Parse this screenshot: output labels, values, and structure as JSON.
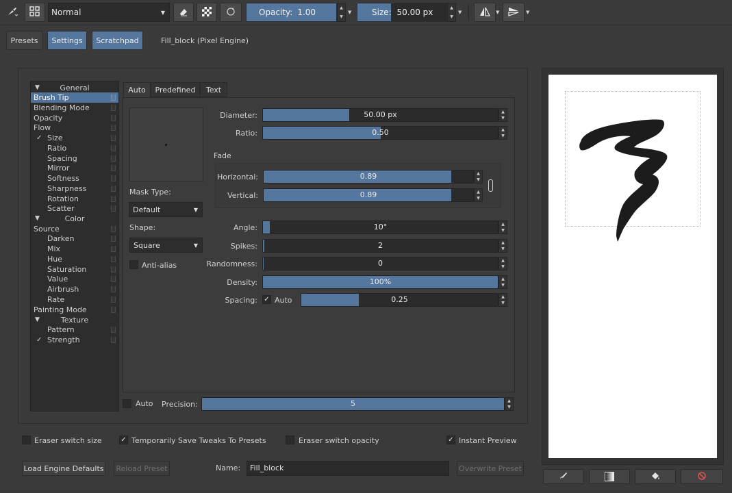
{
  "toolbar": {
    "blend_mode": "Normal",
    "opacity_label": "Opacity:",
    "opacity_value": "1.00",
    "size_label": "Size:",
    "size_value": "50.00 px"
  },
  "tabs": {
    "presets": "Presets",
    "settings": "Settings",
    "scratchpad": "Scratchpad",
    "preset_name": "Fill_block (Pixel Engine)"
  },
  "tree": {
    "general": "General",
    "brush_tip": "Brush Tip",
    "blending_mode": "Blending Mode",
    "opacity": "Opacity",
    "flow": "Flow",
    "size": "Size",
    "ratio": "Ratio",
    "spacing": "Spacing",
    "mirror": "Mirror",
    "softness": "Softness",
    "sharpness": "Sharpness",
    "rotation": "Rotation",
    "scatter": "Scatter",
    "color": "Color",
    "source": "Source",
    "darken": "Darken",
    "mix": "Mix",
    "hue": "Hue",
    "saturation": "Saturation",
    "value": "Value",
    "airbrush": "Airbrush",
    "rate": "Rate",
    "painting_mode": "Painting Mode",
    "texture": "Texture",
    "pattern": "Pattern",
    "strength": "Strength"
  },
  "tip_tabs": {
    "auto": "Auto",
    "predefined": "Predefined",
    "text": "Text"
  },
  "mask": {
    "mask_type_label": "Mask Type:",
    "mask_type_value": "Default",
    "shape_label": "Shape:",
    "shape_value": "Square",
    "anti_alias": "Anti-alias"
  },
  "params": {
    "diameter_label": "Diameter:",
    "diameter_value": "50.00 px",
    "ratio_label": "Ratio:",
    "ratio_value": "0.50",
    "fade_label": "Fade",
    "horizontal_label": "Horizontal:",
    "horizontal_value": "0.89",
    "vertical_label": "Vertical:",
    "vertical_value": "0.89",
    "angle_label": "Angle:",
    "angle_value": "10°",
    "spikes_label": "Spikes:",
    "spikes_value": "2",
    "randomness_label": "Randomness:",
    "randomness_value": "0",
    "density_label": "Density:",
    "density_value": "100%",
    "spacing_label": "Spacing:",
    "spacing_auto": "Auto",
    "spacing_value": "0.25",
    "precision_auto": "Auto",
    "precision_label": "Precision:",
    "precision_value": "5"
  },
  "bottom": {
    "eraser_switch_size": "Eraser switch size",
    "temp_save": "Temporarily Save Tweaks To Presets",
    "eraser_switch_opacity": "Eraser switch opacity",
    "instant_preview": "Instant Preview",
    "load_defaults": "Load Engine Defaults",
    "reload_preset": "Reload Preset",
    "name_label": "Name:",
    "name_value": "Fill_block",
    "overwrite_preset": "Overwrite Preset"
  },
  "colors": {
    "accent": "#55779e",
    "selected": "#51739a",
    "background": "#3a3a3a"
  }
}
